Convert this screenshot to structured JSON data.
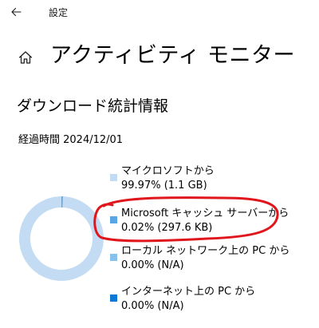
{
  "window": {
    "title": "設定"
  },
  "icons": {
    "back": "back-arrow-icon",
    "home": "home-icon"
  },
  "page": {
    "title": "アクティビティ モニター"
  },
  "section": {
    "title": "ダウンロード統計情報",
    "elapsed": "経過時間 2024/12/01"
  },
  "colors": {
    "from_microsoft": "#c4dcf3",
    "from_cache_server": "#59a6e6",
    "from_local_network": "#86c1ee",
    "from_internet": "#0a78d4",
    "annotation": "#e0161c"
  },
  "legend": [
    {
      "label": "マイクロソフトから",
      "value": "99.97%  (1.1 GB)"
    },
    {
      "label": "Microsoft キャッシュ サーバーから",
      "value": "0.02%  (297.6 KB)"
    },
    {
      "label": "ローカル ネットワーク上の PC から",
      "value": "0.00%  (N/A)"
    },
    {
      "label": "インターネット上の PC から",
      "value": "0.00%  (N/A)"
    }
  ],
  "chart_data": {
    "type": "pie",
    "categories": [
      "マイクロソフトから",
      "Microsoft キャッシュ サーバーから",
      "ローカル ネットワーク上の PC から",
      "インターネット上の PC から"
    ],
    "values": [
      99.97,
      0.02,
      0.0,
      0.0
    ],
    "style": "donut"
  }
}
